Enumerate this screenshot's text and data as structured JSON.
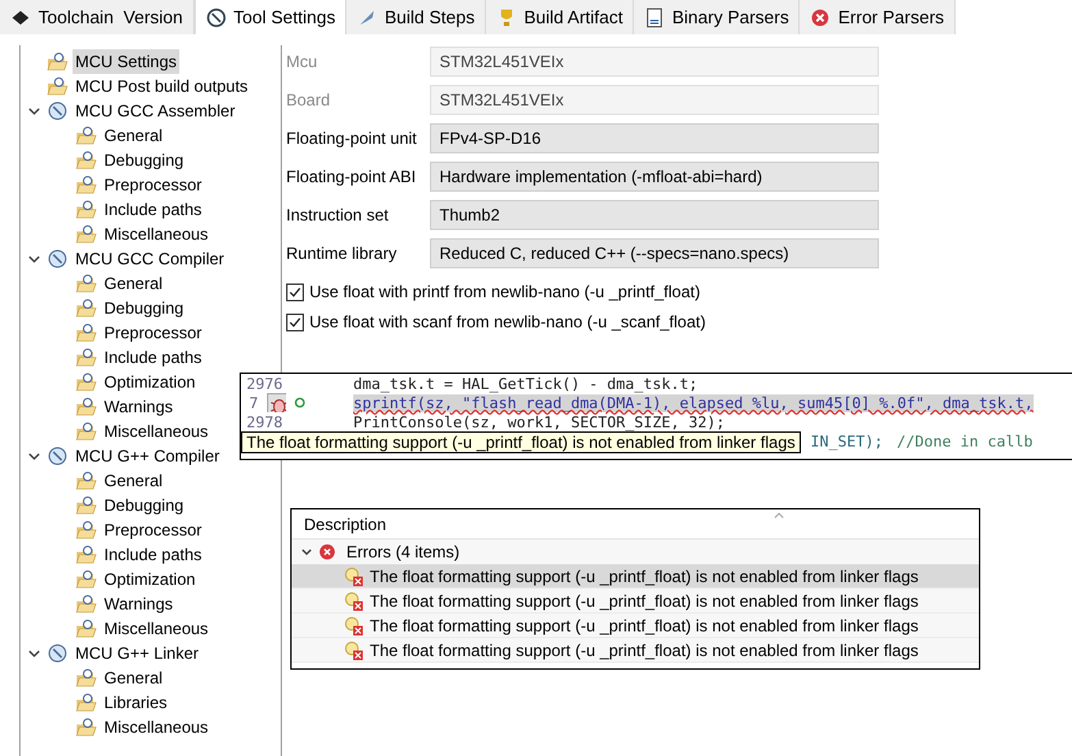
{
  "tabs": [
    {
      "label": "Toolchain  Version",
      "selected": false
    },
    {
      "label": "Tool Settings",
      "selected": true
    },
    {
      "label": "Build Steps",
      "selected": false
    },
    {
      "label": "Build Artifact",
      "selected": false
    },
    {
      "label": "Binary Parsers",
      "selected": false
    },
    {
      "label": "Error Parsers",
      "selected": false
    }
  ],
  "tree": [
    {
      "label": "MCU Settings",
      "selected": true
    },
    {
      "label": "MCU Post build outputs",
      "selected": false
    },
    {
      "label": "MCU GCC Assembler",
      "selected": false,
      "expanded": true,
      "children": [
        {
          "label": "General",
          "selected": false
        },
        {
          "label": "Debugging",
          "selected": false
        },
        {
          "label": "Preprocessor",
          "selected": false
        },
        {
          "label": "Include paths",
          "selected": false
        },
        {
          "label": "Miscellaneous",
          "selected": false
        }
      ]
    },
    {
      "label": "MCU GCC Compiler",
      "selected": false,
      "expanded": true,
      "children": [
        {
          "label": "General",
          "selected": false
        },
        {
          "label": "Debugging",
          "selected": false
        },
        {
          "label": "Preprocessor",
          "selected": false
        },
        {
          "label": "Include paths",
          "selected": false
        },
        {
          "label": "Optimization",
          "selected": false
        },
        {
          "label": "Warnings",
          "selected": false
        },
        {
          "label": "Miscellaneous",
          "selected": false
        }
      ]
    },
    {
      "label": "MCU G++ Compiler",
      "selected": false,
      "expanded": true,
      "children": [
        {
          "label": "General",
          "selected": false
        },
        {
          "label": "Debugging",
          "selected": false
        },
        {
          "label": "Preprocessor",
          "selected": false
        },
        {
          "label": "Include paths",
          "selected": false
        },
        {
          "label": "Optimization",
          "selected": false
        },
        {
          "label": "Warnings",
          "selected": false
        },
        {
          "label": "Miscellaneous",
          "selected": false
        }
      ]
    },
    {
      "label": "MCU G++ Linker",
      "selected": false,
      "expanded": true,
      "children": [
        {
          "label": "General",
          "selected": false
        },
        {
          "label": "Libraries",
          "selected": false
        },
        {
          "label": "Miscellaneous",
          "selected": false
        }
      ]
    }
  ],
  "settings": [
    {
      "kind": "field",
      "label": "Mcu",
      "value": "STM32L451VEIx",
      "disabled": true
    },
    {
      "kind": "field",
      "label": "Board",
      "value": "STM32L451VEIx",
      "disabled": true
    },
    {
      "kind": "field",
      "label": "Floating-point unit",
      "value": "FPv4-SP-D16",
      "disabled": false
    },
    {
      "kind": "field",
      "label": "Floating-point ABI",
      "value": "Hardware implementation (-mfloat-abi=hard)",
      "disabled": false
    },
    {
      "kind": "field",
      "label": "Instruction set",
      "value": "Thumb2",
      "disabled": false
    },
    {
      "kind": "field",
      "label": "Runtime library",
      "value": "Reduced C, reduced C++ (--specs=nano.specs)",
      "disabled": false
    },
    {
      "kind": "checkbox",
      "label": "Use float with printf from newlib-nano (-u _printf_float)",
      "checked": true
    },
    {
      "kind": "checkbox",
      "label": "Use float with scanf from newlib-nano (-u _scanf_float)",
      "checked": true
    }
  ],
  "editor": {
    "lines": [
      {
        "number": "2976",
        "code": "dma_tsk.t = HAL_GetTick() - dma_tsk.t;",
        "error": false
      },
      {
        "number": "7",
        "code": "sprintf(sz, \"flash_read_dma(DMA-1), elapsed %lu, sum45[0] %.0f\", dma_tsk.t,",
        "error": true
      },
      {
        "number": "2978",
        "code": "PrintConsole(sz, work1, SECTOR_SIZE, 32);",
        "error": false
      },
      {
        "code": "IN_SET);",
        "comment": "//Done in callb",
        "error": false
      }
    ],
    "tooltip": "The float formatting support (-u _printf_float) is not enabled from linker flags"
  },
  "problems": {
    "column": "Description",
    "group": {
      "label": "Errors (4 items)",
      "expanded": true
    },
    "rows": [
      {
        "text": "The float formatting support (-u _printf_float) is not enabled from linker flags",
        "selected": true
      },
      {
        "text": "The float formatting support (-u _printf_float) is not enabled from linker flags",
        "selected": false
      },
      {
        "text": "The float formatting support (-u _printf_float) is not enabled from linker flags",
        "selected": false
      },
      {
        "text": "The float formatting support (-u _printf_float) is not enabled from linker flags",
        "selected": false
      }
    ]
  }
}
